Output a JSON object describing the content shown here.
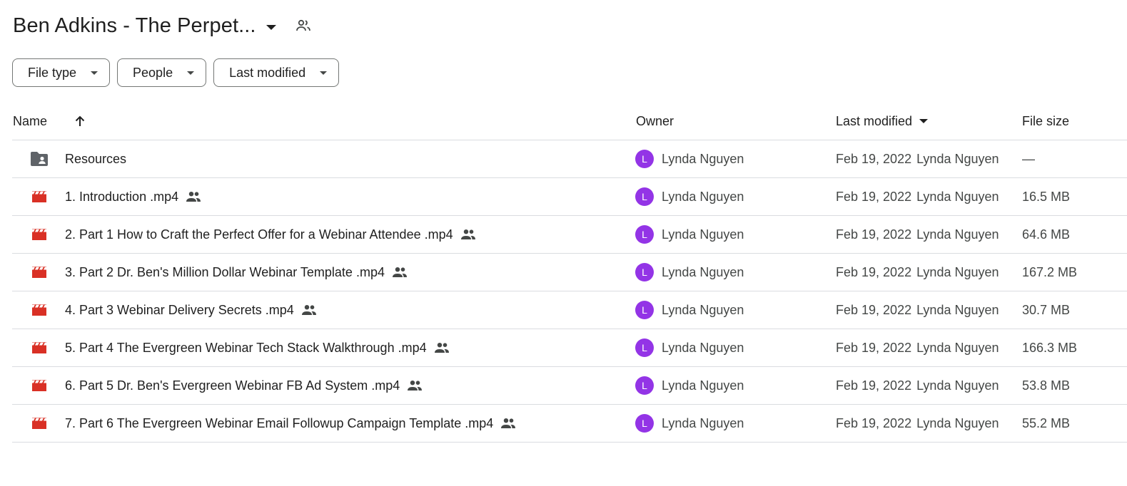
{
  "header": {
    "title": "Ben Adkins - The Perpet..."
  },
  "filters": [
    {
      "label": "File type"
    },
    {
      "label": "People"
    },
    {
      "label": "Last modified"
    }
  ],
  "columns": {
    "name": "Name",
    "owner": "Owner",
    "last_modified": "Last modified",
    "file_size": "File size"
  },
  "colors": {
    "video_icon": "#d93025",
    "folder_icon": "#5f6368",
    "avatar": "#9334e6"
  },
  "rows": [
    {
      "icon": "shared-folder-icon",
      "name": "Resources",
      "shared": false,
      "owner": "Lynda Nguyen",
      "avatar": "L",
      "date": "Feb 19, 2022",
      "modified_by": "Lynda Nguyen",
      "size": "—"
    },
    {
      "icon": "video-file-icon",
      "name": "1. Introduction .mp4",
      "shared": true,
      "owner": "Lynda Nguyen",
      "avatar": "L",
      "date": "Feb 19, 2022",
      "modified_by": "Lynda Nguyen",
      "size": "16.5 MB"
    },
    {
      "icon": "video-file-icon",
      "name": "2. Part 1 How to Craft the Perfect Offer for a Webinar Attendee .mp4",
      "shared": true,
      "owner": "Lynda Nguyen",
      "avatar": "L",
      "date": "Feb 19, 2022",
      "modified_by": "Lynda Nguyen",
      "size": "64.6 MB"
    },
    {
      "icon": "video-file-icon",
      "name": "3. Part 2 Dr. Ben's Million Dollar Webinar Template .mp4",
      "shared": true,
      "owner": "Lynda Nguyen",
      "avatar": "L",
      "date": "Feb 19, 2022",
      "modified_by": "Lynda Nguyen",
      "size": "167.2 MB"
    },
    {
      "icon": "video-file-icon",
      "name": "4. Part 3 Webinar Delivery Secrets .mp4",
      "shared": true,
      "owner": "Lynda Nguyen",
      "avatar": "L",
      "date": "Feb 19, 2022",
      "modified_by": "Lynda Nguyen",
      "size": "30.7 MB"
    },
    {
      "icon": "video-file-icon",
      "name": "5. Part 4 The Evergreen Webinar Tech Stack Walkthrough .mp4",
      "shared": true,
      "owner": "Lynda Nguyen",
      "avatar": "L",
      "date": "Feb 19, 2022",
      "modified_by": "Lynda Nguyen",
      "size": "166.3 MB"
    },
    {
      "icon": "video-file-icon",
      "name": "6. Part 5 Dr. Ben's Evergreen Webinar FB Ad System .mp4",
      "shared": true,
      "owner": "Lynda Nguyen",
      "avatar": "L",
      "date": "Feb 19, 2022",
      "modified_by": "Lynda Nguyen",
      "size": "53.8 MB"
    },
    {
      "icon": "video-file-icon",
      "name": "7. Part 6 The Evergreen Webinar Email Followup Campaign Template .mp4",
      "shared": true,
      "owner": "Lynda Nguyen",
      "avatar": "L",
      "date": "Feb 19, 2022",
      "modified_by": "Lynda Nguyen",
      "size": "55.2 MB"
    }
  ]
}
